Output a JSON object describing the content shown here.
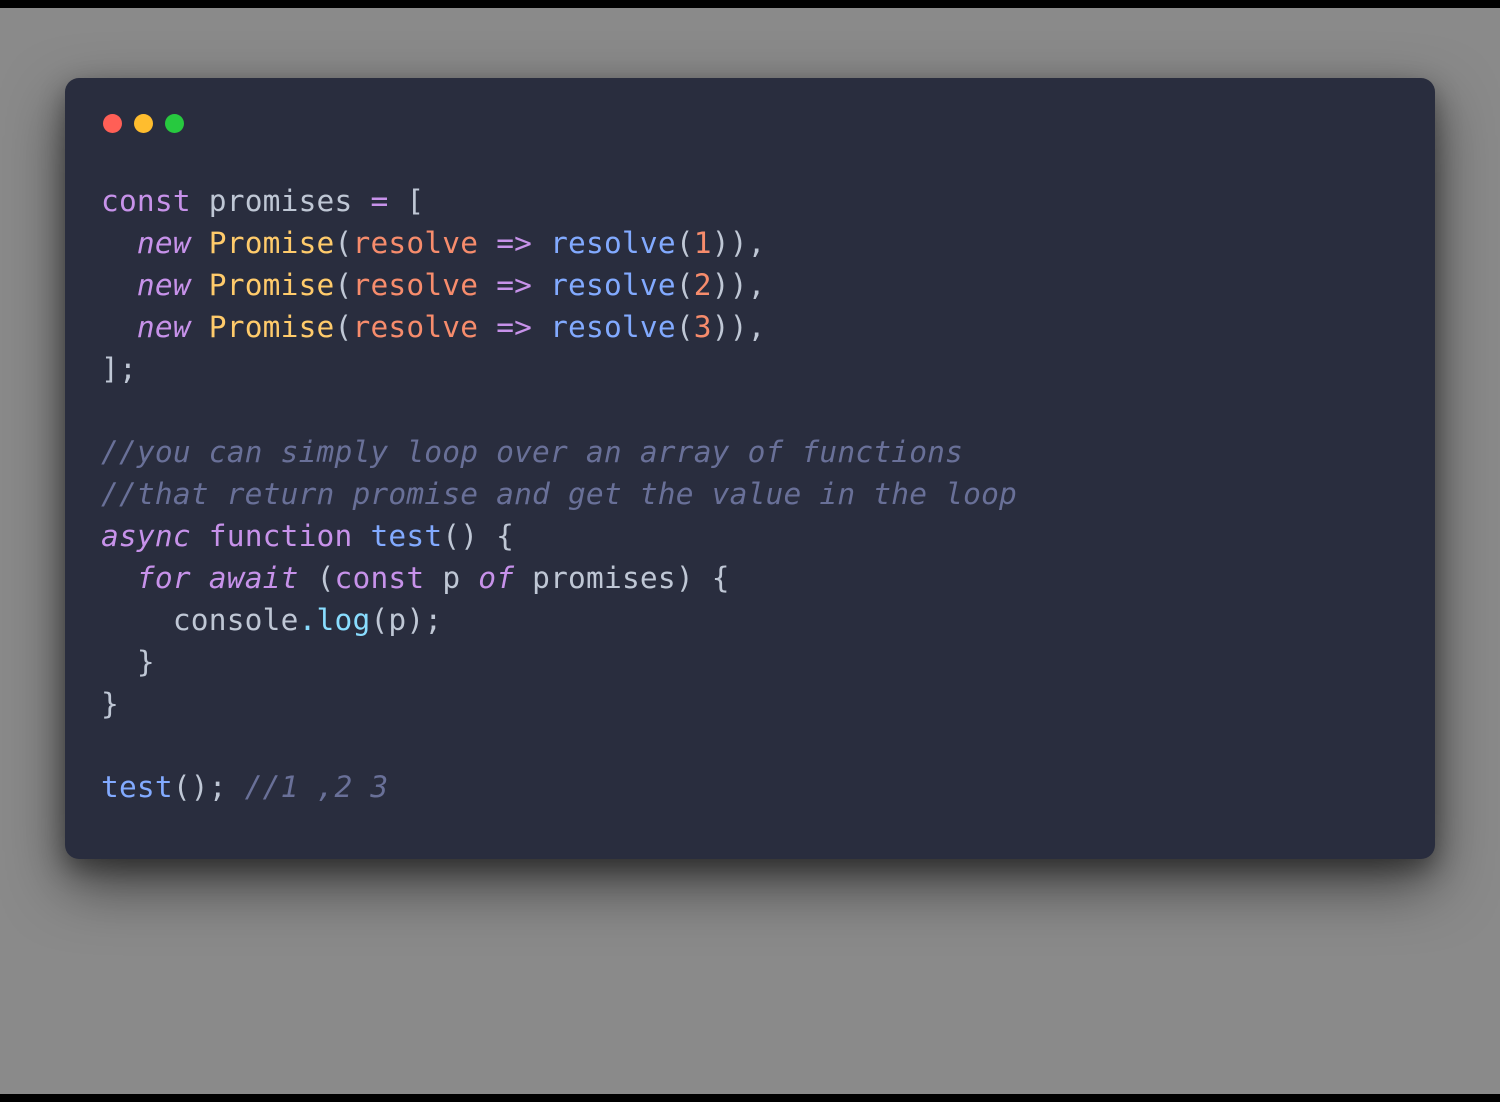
{
  "traffic": {
    "red": "#ff5f56",
    "yellow": "#ffbd2e",
    "green": "#27c93f"
  },
  "code": {
    "l1": {
      "const": "const",
      "promises": "promises",
      "eq": "=",
      "lbrack": "["
    },
    "l2": {
      "new": "new",
      "Promise": "Promise",
      "resolve": "resolve",
      "arrow": "=>",
      "resolveCall": "resolve",
      "num": "1"
    },
    "l3": {
      "new": "new",
      "Promise": "Promise",
      "resolve": "resolve",
      "arrow": "=>",
      "resolveCall": "resolve",
      "num": "2"
    },
    "l4": {
      "new": "new",
      "Promise": "Promise",
      "resolve": "resolve",
      "arrow": "=>",
      "resolveCall": "resolve",
      "num": "3"
    },
    "l5": {
      "rbrack": "];"
    },
    "c1": "//you can simply loop over an array of functions",
    "c2": "//that return promise and get the value in the loop",
    "l6": {
      "async": "async",
      "function": "function",
      "test": "test",
      "parens": "()",
      "brace": "{"
    },
    "l7": {
      "for": "for",
      "await": "await",
      "const": "const",
      "p": "p",
      "of": "of",
      "promises": "promises",
      "brace": "{"
    },
    "l8": {
      "console": "console",
      "dot": ".",
      "log": "log",
      "p": "p"
    },
    "l9": {
      "brace": "}"
    },
    "l10": {
      "brace": "}"
    },
    "l11": {
      "test": "test",
      "parens": "();",
      "comment": "//1 ,2 3"
    }
  }
}
